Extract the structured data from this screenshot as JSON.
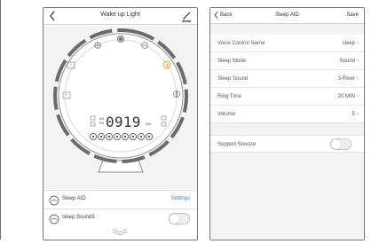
{
  "phone1": {
    "title": "Wake up Light",
    "clock": {
      "am_label": "AM",
      "pm_label": "PM",
      "time_digits": "0919",
      "min_label": "MIN"
    },
    "rows": [
      {
        "label": "Sleep AID",
        "link": "Settings"
      },
      {
        "label": "sleep Sound3",
        "toggle_on": false
      }
    ]
  },
  "phone2": {
    "back_label": "Back",
    "title": "Sleep AID",
    "save_label": "Save",
    "settings": [
      {
        "label": "Voice Control Name",
        "value": "sleep"
      },
      {
        "label": "Sleep Mode",
        "value": "Sound"
      },
      {
        "label": "Sleep Sound",
        "value": "3-River"
      },
      {
        "label": "Ring Time",
        "value": "20 MIN"
      },
      {
        "label": "Volume",
        "value": "5"
      }
    ],
    "snooze": {
      "label": "Support Snooze",
      "toggle_on": false
    }
  },
  "colors": {
    "accent_orange": "#e8902a",
    "link_blue": "#3c7fd1",
    "dark_gray": "#6b6b6b"
  }
}
